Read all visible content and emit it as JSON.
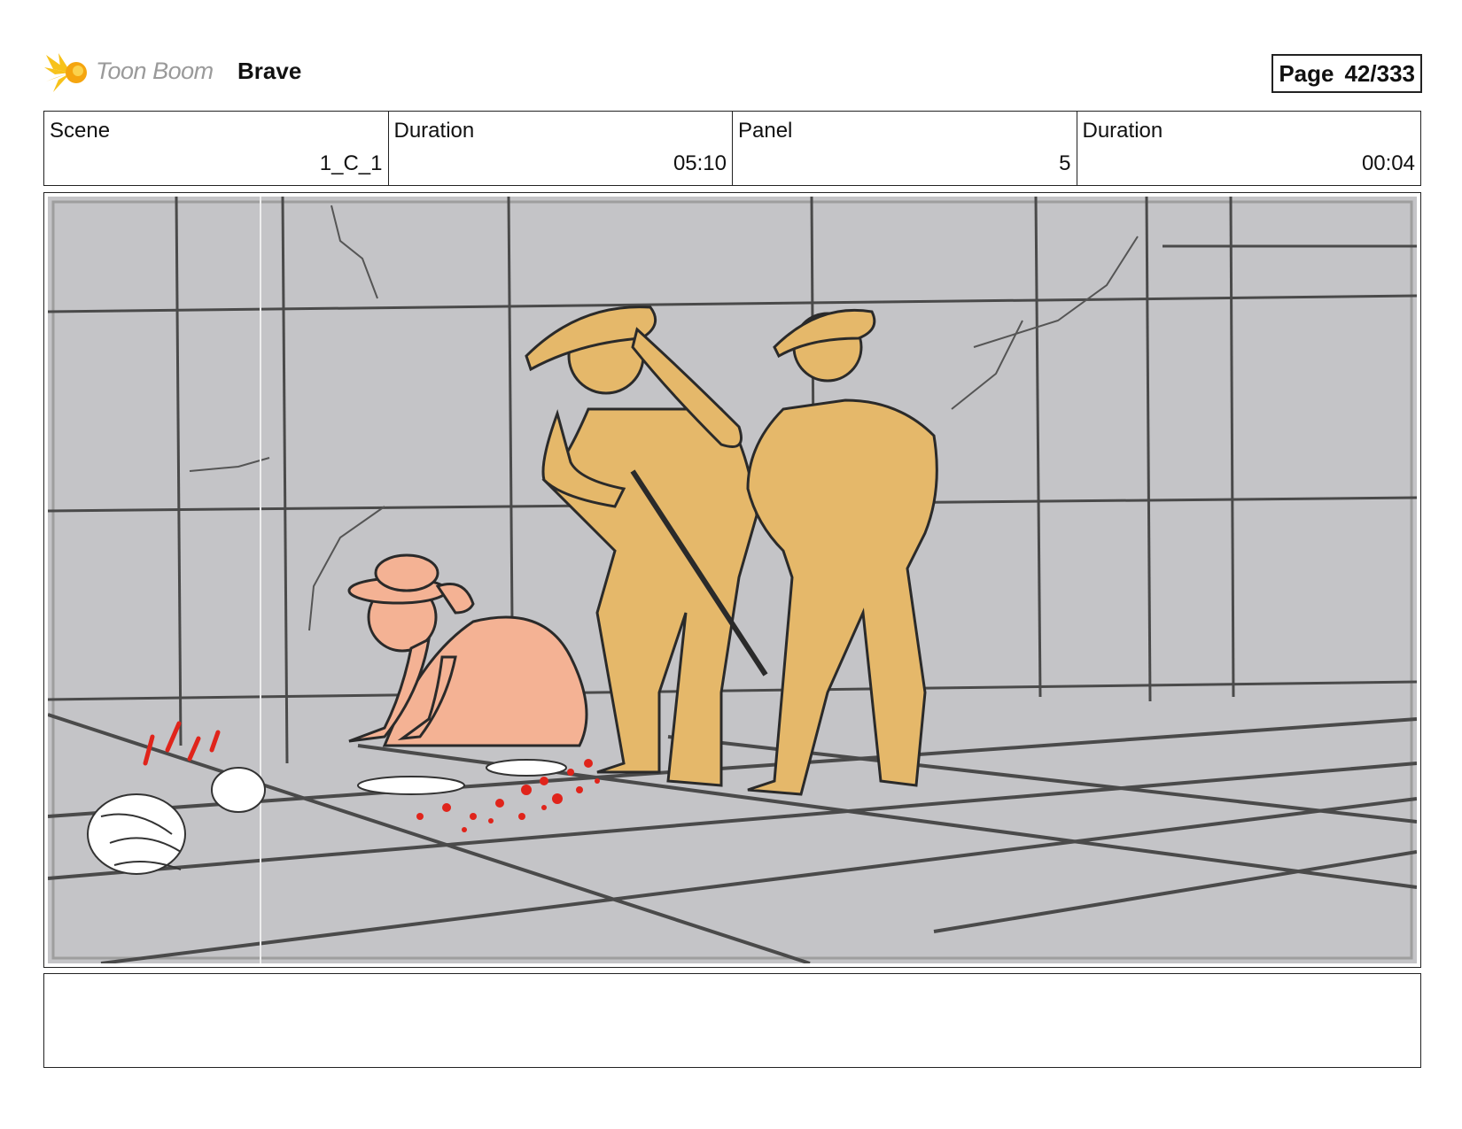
{
  "header": {
    "brand": "Toon Boom",
    "project": "Brave",
    "page_label": "Page",
    "page_number": "42/333"
  },
  "info": {
    "scene_label": "Scene",
    "scene_value": "1_C_1",
    "scene_duration_label": "Duration",
    "scene_duration_value": "05:10",
    "panel_label": "Panel",
    "panel_value": "5",
    "panel_duration_label": "Duration",
    "panel_duration_value": "00:04"
  },
  "panel_art": {
    "icon": "storyboard-sketch",
    "colors": {
      "background": "#c4c4c7",
      "soldier": "#e5b86a",
      "girl": "#f4b294",
      "blood": "#e0241b",
      "line": "#3a3a3a"
    }
  },
  "notes": {
    "text": ""
  }
}
